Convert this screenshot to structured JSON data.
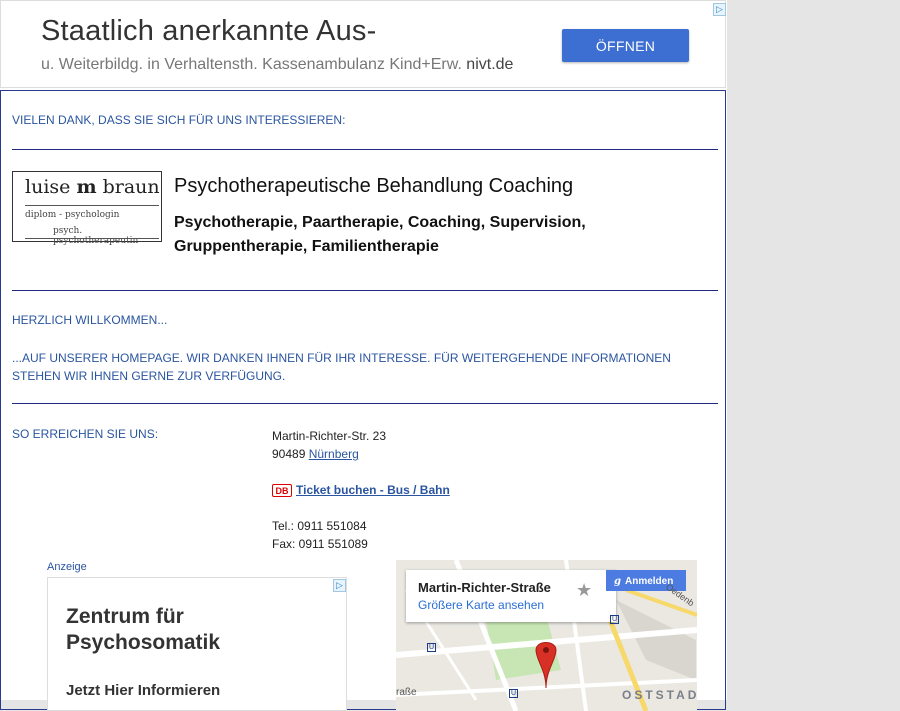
{
  "top_ad": {
    "headline": "Staatlich anerkannte Aus-",
    "subline": "u. Weiterbildg. in Verhaltensth. Kassenambulanz Kind+Erw.",
    "domain": "nivt.de",
    "button": "ÖFFNEN",
    "adchoices_icon": "adchoices-icon"
  },
  "thanks": "VIELEN DANK, DASS SIE SICH FÜR UNS INTERESSIEREN:",
  "logo": {
    "name_left": "luise",
    "name_mark": "m",
    "name_right": "braun",
    "line1": "diplom - psychologin",
    "line2": "psych. psychotherapeutin"
  },
  "heading": "Psychotherapeutische Behandlung Coaching",
  "services": "Psychotherapie, Paartherapie, Coaching, Supervision, Gruppentherapie, Familientherapie",
  "welcome": "HERZLICH WILLKOMMEN...",
  "intro": "...AUF UNSERER HOMEPAGE. WIR DANKEN IHNEN FÜR IHR INTERESSE. FÜR WEITERGEHENDE INFORMATIONEN STEHEN WIR IHNEN GERNE ZUR VERFÜGUNG.",
  "reach_label": "SO ERREICHEN SIE UNS:",
  "address": {
    "street": "Martin-Richter-Str. 23",
    "zip": "90489",
    "city": "Nürnberg",
    "db_logo": "DB",
    "ticket": "Ticket buchen - Bus / Bahn",
    "tel": "Tel.: 0911 551084",
    "fax": "Fax: 0911 551089"
  },
  "ad2": {
    "label": "Anzeige",
    "title": "Zentrum für Psychosomatik",
    "cta": "Jetzt Hier Informieren"
  },
  "map": {
    "street": "Martin-Richter-Straße",
    "larger_map": "Größere Karte ansehen",
    "signin_g": "g",
    "signin": "Anmelden",
    "district": "OSTSTADT",
    "road_label": "Oedenb",
    "street_fragment": "raße",
    "transit_u": "U",
    "colors": {
      "marker": "#d93025",
      "park": "#c8e6b4",
      "road_major": "#f7d86b",
      "road": "#ffffff"
    }
  }
}
